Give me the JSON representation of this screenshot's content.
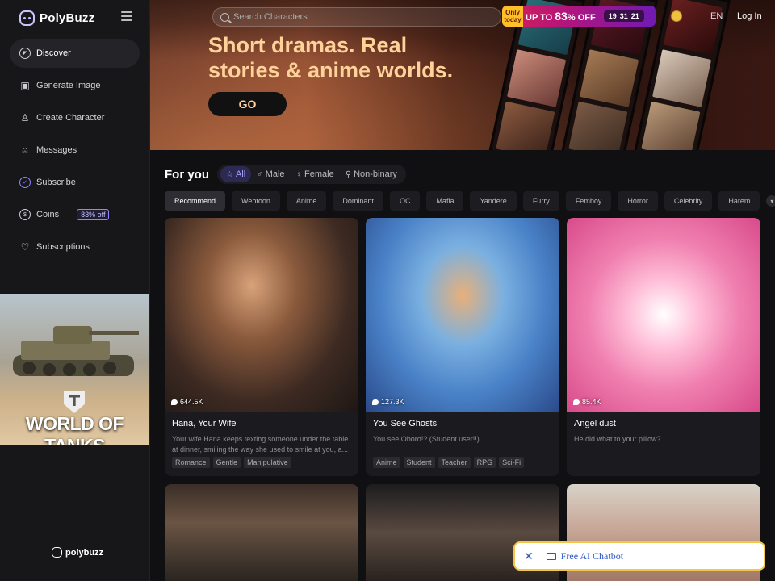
{
  "app": {
    "name": "PolyBuzz"
  },
  "sidebar": {
    "items": [
      {
        "label": "Discover",
        "icon": "compass-icon",
        "active": true
      },
      {
        "label": "Generate Image",
        "icon": "image-plus-icon",
        "active": false
      },
      {
        "label": "Create Character",
        "icon": "user-plus-icon",
        "active": false
      },
      {
        "label": "Messages",
        "icon": "bell-icon",
        "active": false
      },
      {
        "label": "Subscribe",
        "icon": "subscribe-icon",
        "active": false
      },
      {
        "label": "Coins",
        "icon": "dollar-coin-icon",
        "active": false,
        "badge": "83% off"
      },
      {
        "label": "Subscriptions",
        "icon": "heart-chat-icon",
        "active": false
      }
    ],
    "ad": {
      "brand": "WORLD OF TANKS"
    },
    "footer_brand": "polybuzz"
  },
  "header": {
    "search_placeholder": "Search Characters",
    "promo": {
      "badge": "Only today",
      "text_prefix": "UP TO ",
      "percent": "83",
      "text_suffix": "% OFF",
      "countdown": [
        "19",
        "31",
        "21"
      ]
    },
    "language": "EN",
    "login": "Log In"
  },
  "hero": {
    "title": "Short dramas. Real stories & anime worlds.",
    "cta": "GO"
  },
  "feed": {
    "heading": "For you",
    "gender_tabs": [
      {
        "label": "All",
        "icon": "star-icon",
        "active": true
      },
      {
        "label": "Male",
        "icon": "male-icon",
        "active": false
      },
      {
        "label": "Female",
        "icon": "female-icon",
        "active": false
      },
      {
        "label": "Non-binary",
        "icon": "nonbinary-icon",
        "active": false
      }
    ],
    "category_tags": [
      "Recommend",
      "Webtoon",
      "Anime",
      "Dominant",
      "OC",
      "Mafia",
      "Yandere",
      "Furry",
      "Femboy",
      "Horror",
      "Celebrity",
      "Harem"
    ],
    "cards": [
      {
        "title": "Hana, Your Wife",
        "chats": "644.5K",
        "desc": "Your wife Hana keeps texting someone under the table at dinner, smiling the way she used to smile at you, a...",
        "tags": [
          "Romance",
          "Gentle",
          "Manipulative"
        ]
      },
      {
        "title": "You See Ghosts",
        "chats": "127.3K",
        "desc": "You see Oboro!? (Student user!!)",
        "tags": [
          "Anime",
          "Student",
          "Teacher",
          "RPG",
          "Sci-Fi"
        ]
      },
      {
        "title": "Angel dust",
        "chats": "85.4K",
        "desc": "He did what to your pillow?",
        "tags": []
      }
    ]
  },
  "chatbot_popup": {
    "label": "Free AI Chatbot"
  },
  "colors": {
    "accent": "#8d86ff",
    "hero_title": "#ffd29a",
    "promo_pink": "#d6205a",
    "chatbot_border": "#f3c648"
  }
}
